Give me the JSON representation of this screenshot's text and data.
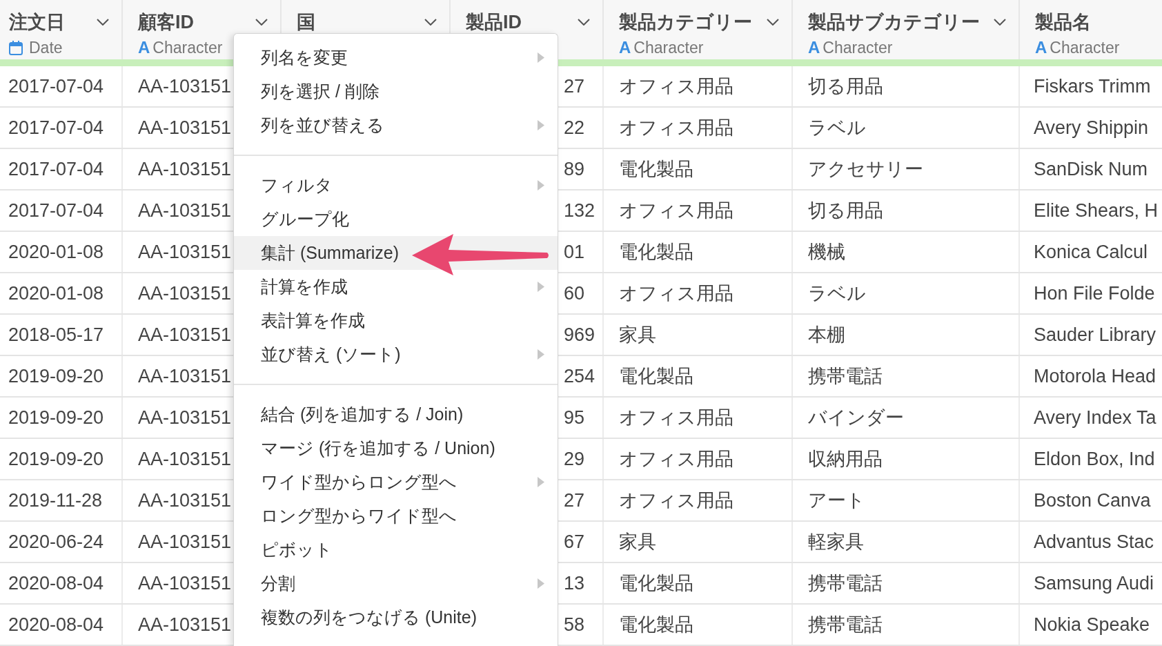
{
  "table": {
    "columns": [
      {
        "name": "注文日",
        "menu_button": true,
        "data_type": {
          "kind": "date",
          "label": "Date"
        }
      },
      {
        "name": "顧客ID",
        "menu_button": true,
        "data_type": {
          "kind": "character",
          "icon_text": "A",
          "label": "Character"
        }
      },
      {
        "name": "国",
        "menu_button": true
      },
      {
        "name": "製品ID",
        "menu_button": true
      },
      {
        "name": "製品カテゴリー",
        "menu_button": true,
        "data_type": {
          "kind": "character",
          "icon_text": "A",
          "label": "Character"
        }
      },
      {
        "name": "製品サブカテゴリー",
        "menu_button": true,
        "data_type": {
          "kind": "character",
          "icon_text": "A",
          "label": "Character"
        }
      },
      {
        "name": "製品名",
        "menu_button": false,
        "data_type": {
          "kind": "character",
          "icon_text": "A",
          "label": "Character"
        }
      }
    ],
    "rows": [
      {
        "order_date": "2017-07-04",
        "customer_id": "AA-103151",
        "product_id": "27",
        "product_category": "オフィス用品",
        "product_subcategory": "切る用品",
        "product_name": "Fiskars Trimm"
      },
      {
        "order_date": "2017-07-04",
        "customer_id": "AA-103151",
        "product_id": "22",
        "product_category": "オフィス用品",
        "product_subcategory": "ラベル",
        "product_name": "Avery Shippin"
      },
      {
        "order_date": "2017-07-04",
        "customer_id": "AA-103151",
        "product_id": "89",
        "product_category": "電化製品",
        "product_subcategory": "アクセサリー",
        "product_name": "SanDisk Num"
      },
      {
        "order_date": "2017-07-04",
        "customer_id": "AA-103151",
        "product_id": "132",
        "product_category": "オフィス用品",
        "product_subcategory": "切る用品",
        "product_name": "Elite Shears, H"
      },
      {
        "order_date": "2020-01-08",
        "customer_id": "AA-103151",
        "product_id": "01",
        "product_category": "電化製品",
        "product_subcategory": "機械",
        "product_name": "Konica Calcul"
      },
      {
        "order_date": "2020-01-08",
        "customer_id": "AA-103151",
        "product_id": "60",
        "product_category": "オフィス用品",
        "product_subcategory": "ラベル",
        "product_name": "Hon File Folde"
      },
      {
        "order_date": "2018-05-17",
        "customer_id": "AA-103151",
        "product_id": "969",
        "product_category": "家具",
        "product_subcategory": "本棚",
        "product_name": "Sauder Library"
      },
      {
        "order_date": "2019-09-20",
        "customer_id": "AA-103151",
        "product_id": "254",
        "product_category": "電化製品",
        "product_subcategory": "携帯電話",
        "product_name": "Motorola Head"
      },
      {
        "order_date": "2019-09-20",
        "customer_id": "AA-103151",
        "product_id": "95",
        "product_category": "オフィス用品",
        "product_subcategory": "バインダー",
        "product_name": "Avery Index Ta"
      },
      {
        "order_date": "2019-09-20",
        "customer_id": "AA-103151",
        "product_id": "29",
        "product_category": "オフィス用品",
        "product_subcategory": "収納用品",
        "product_name": "Eldon Box, Ind"
      },
      {
        "order_date": "2019-11-28",
        "customer_id": "AA-103151",
        "product_id": "27",
        "product_category": "オフィス用品",
        "product_subcategory": "アート",
        "product_name": "Boston Canva"
      },
      {
        "order_date": "2020-06-24",
        "customer_id": "AA-103151",
        "product_id": "67",
        "product_category": "家具",
        "product_subcategory": "軽家具",
        "product_name": "Advantus Stac"
      },
      {
        "order_date": "2020-08-04",
        "customer_id": "AA-103151",
        "product_id": "13",
        "product_category": "電化製品",
        "product_subcategory": "携帯電話",
        "product_name": "Samsung Audi"
      },
      {
        "order_date": "2020-08-04",
        "customer_id": "AA-103151",
        "product_id": "58",
        "product_category": "電化製品",
        "product_subcategory": "携帯電話",
        "product_name": "Nokia Speake"
      }
    ]
  },
  "column_menu": {
    "sections": [
      {
        "items": [
          {
            "label": "列名を変更",
            "submenu": true,
            "selected": false
          },
          {
            "label": "列を選択 / 削除",
            "submenu": false,
            "selected": false
          },
          {
            "label": "列を並び替える",
            "submenu": true,
            "selected": false
          }
        ]
      },
      {
        "items": [
          {
            "label": "フィルタ",
            "submenu": true,
            "selected": false
          },
          {
            "label": "グループ化",
            "submenu": false,
            "selected": false
          },
          {
            "label": "集計 (Summarize)",
            "submenu": false,
            "selected": true
          },
          {
            "label": "計算を作成",
            "submenu": true,
            "selected": false
          },
          {
            "label": "表計算を作成",
            "submenu": false,
            "selected": false
          },
          {
            "label": "並び替え (ソート)",
            "submenu": true,
            "selected": false
          }
        ]
      },
      {
        "items": [
          {
            "label": "結合 (列を追加する / Join)",
            "submenu": false,
            "selected": false
          },
          {
            "label": "マージ (行を追加する / Union)",
            "submenu": false,
            "selected": false
          },
          {
            "label": "ワイド型からロング型へ",
            "submenu": true,
            "selected": false
          },
          {
            "label": "ロング型からワイド型へ",
            "submenu": false,
            "selected": false
          },
          {
            "label": "ピボット",
            "submenu": false,
            "selected": false
          },
          {
            "label": "分割",
            "submenu": true,
            "selected": false
          },
          {
            "label": "複数の列をつなげる (Unite)",
            "submenu": false,
            "selected": false
          }
        ]
      }
    ]
  }
}
